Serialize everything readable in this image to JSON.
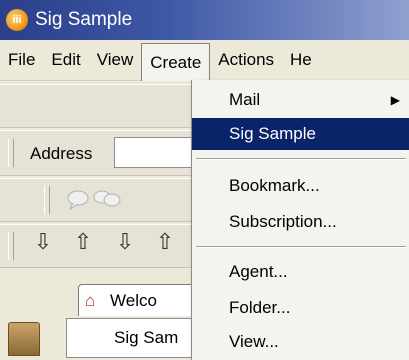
{
  "window": {
    "title": "Sig Sample",
    "icon": "app-icon",
    "icon_text": "iii"
  },
  "menubar": {
    "items": [
      {
        "label": "File"
      },
      {
        "label": "Edit"
      },
      {
        "label": "View"
      },
      {
        "label": "Create",
        "active": true
      },
      {
        "label": "Actions"
      },
      {
        "label": "He"
      }
    ]
  },
  "address": {
    "label": "Address",
    "value": ""
  },
  "tab": {
    "label": "Welco",
    "icon": "home-icon"
  },
  "lower": {
    "label": "Sig Sam"
  },
  "dropdown": {
    "items": [
      {
        "label": "Mail",
        "submenu": true,
        "arrow": "▶"
      },
      {
        "label": "Sig Sample",
        "highlighted": true
      },
      {
        "label": "Bookmark..."
      },
      {
        "label": "Subscription..."
      },
      {
        "label": "Agent..."
      },
      {
        "label": "Folder..."
      },
      {
        "label": "View..."
      }
    ]
  },
  "colors": {
    "title_bar": "#2b3f8a",
    "highlight": "#0a246a",
    "menu_bg": "#ece9d8"
  },
  "toolbar": {
    "icons": [
      "speech-bubble-icon",
      "double-speech-bubble-icon"
    ]
  },
  "nav_buttons": {
    "glyphs": [
      "⇩",
      "⇧",
      "⇩",
      "⇧"
    ]
  }
}
